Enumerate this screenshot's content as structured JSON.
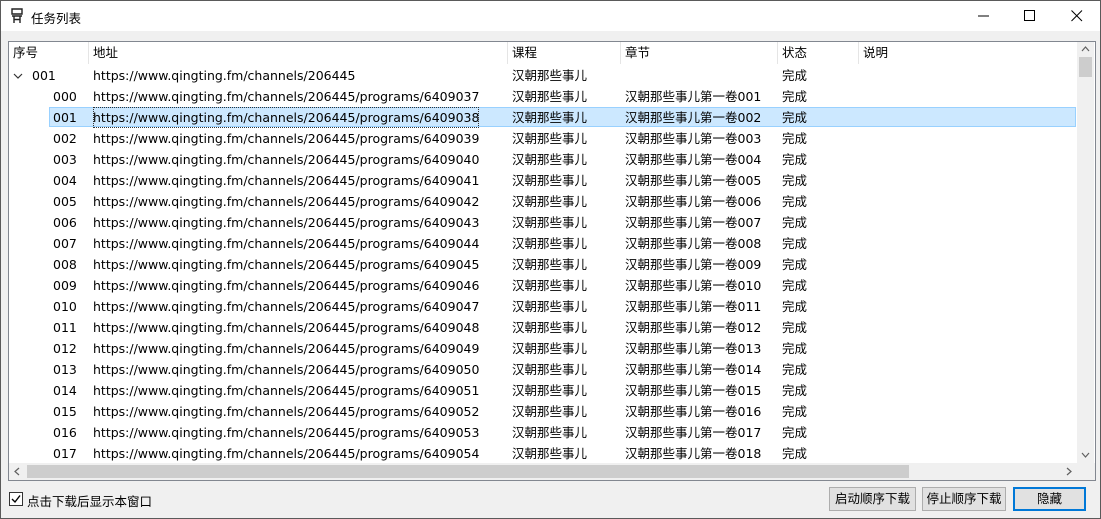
{
  "window": {
    "title": "任务列表"
  },
  "columns": [
    "序号",
    "地址",
    "课程",
    "章节",
    "状态",
    "说明"
  ],
  "parent_row": {
    "index": "001",
    "url": "https://www.qingting.fm/channels/206445",
    "course": "汉朝那些事儿",
    "chapter": "",
    "status": "完成",
    "note": ""
  },
  "rows": [
    {
      "index": "000",
      "url": "https://www.qingting.fm/channels/206445/programs/6409037",
      "course": "汉朝那些事儿",
      "chapter": "汉朝那些事儿第一卷001",
      "status": "完成",
      "note": ""
    },
    {
      "index": "001",
      "url": "https://www.qingting.fm/channels/206445/programs/6409038",
      "course": "汉朝那些事儿",
      "chapter": "汉朝那些事儿第一卷002",
      "status": "完成",
      "note": ""
    },
    {
      "index": "002",
      "url": "https://www.qingting.fm/channels/206445/programs/6409039",
      "course": "汉朝那些事儿",
      "chapter": "汉朝那些事儿第一卷003",
      "status": "完成",
      "note": ""
    },
    {
      "index": "003",
      "url": "https://www.qingting.fm/channels/206445/programs/6409040",
      "course": "汉朝那些事儿",
      "chapter": "汉朝那些事儿第一卷004",
      "status": "完成",
      "note": ""
    },
    {
      "index": "004",
      "url": "https://www.qingting.fm/channels/206445/programs/6409041",
      "course": "汉朝那些事儿",
      "chapter": "汉朝那些事儿第一卷005",
      "status": "完成",
      "note": ""
    },
    {
      "index": "005",
      "url": "https://www.qingting.fm/channels/206445/programs/6409042",
      "course": "汉朝那些事儿",
      "chapter": "汉朝那些事儿第一卷006",
      "status": "完成",
      "note": ""
    },
    {
      "index": "006",
      "url": "https://www.qingting.fm/channels/206445/programs/6409043",
      "course": "汉朝那些事儿",
      "chapter": "汉朝那些事儿第一卷007",
      "status": "完成",
      "note": ""
    },
    {
      "index": "007",
      "url": "https://www.qingting.fm/channels/206445/programs/6409044",
      "course": "汉朝那些事儿",
      "chapter": "汉朝那些事儿第一卷008",
      "status": "完成",
      "note": ""
    },
    {
      "index": "008",
      "url": "https://www.qingting.fm/channels/206445/programs/6409045",
      "course": "汉朝那些事儿",
      "chapter": "汉朝那些事儿第一卷009",
      "status": "完成",
      "note": ""
    },
    {
      "index": "009",
      "url": "https://www.qingting.fm/channels/206445/programs/6409046",
      "course": "汉朝那些事儿",
      "chapter": "汉朝那些事儿第一卷010",
      "status": "完成",
      "note": ""
    },
    {
      "index": "010",
      "url": "https://www.qingting.fm/channels/206445/programs/6409047",
      "course": "汉朝那些事儿",
      "chapter": "汉朝那些事儿第一卷011",
      "status": "完成",
      "note": ""
    },
    {
      "index": "011",
      "url": "https://www.qingting.fm/channels/206445/programs/6409048",
      "course": "汉朝那些事儿",
      "chapter": "汉朝那些事儿第一卷012",
      "status": "完成",
      "note": ""
    },
    {
      "index": "012",
      "url": "https://www.qingting.fm/channels/206445/programs/6409049",
      "course": "汉朝那些事儿",
      "chapter": "汉朝那些事儿第一卷013",
      "status": "完成",
      "note": ""
    },
    {
      "index": "013",
      "url": "https://www.qingting.fm/channels/206445/programs/6409050",
      "course": "汉朝那些事儿",
      "chapter": "汉朝那些事儿第一卷014",
      "status": "完成",
      "note": ""
    },
    {
      "index": "014",
      "url": "https://www.qingting.fm/channels/206445/programs/6409051",
      "course": "汉朝那些事儿",
      "chapter": "汉朝那些事儿第一卷015",
      "status": "完成",
      "note": ""
    },
    {
      "index": "015",
      "url": "https://www.qingting.fm/channels/206445/programs/6409052",
      "course": "汉朝那些事儿",
      "chapter": "汉朝那些事儿第一卷016",
      "status": "完成",
      "note": ""
    },
    {
      "index": "016",
      "url": "https://www.qingting.fm/channels/206445/programs/6409053",
      "course": "汉朝那些事儿",
      "chapter": "汉朝那些事儿第一卷017",
      "status": "完成",
      "note": ""
    },
    {
      "index": "017",
      "url": "https://www.qingting.fm/channels/206445/programs/6409054",
      "course": "汉朝那些事儿",
      "chapter": "汉朝那些事儿第一卷018",
      "status": "完成",
      "note": ""
    }
  ],
  "selected_row": 1,
  "footer": {
    "checkbox_label": "点击下载后显示本窗口",
    "checkbox_checked": true,
    "start_button": "启动顺序下载",
    "stop_button": "停止顺序下载",
    "hide_button": "隐藏"
  },
  "colors": {
    "selection_bg": "#cce8ff",
    "selection_border": "#99d1ff",
    "default_button_border": "#0078d7"
  }
}
